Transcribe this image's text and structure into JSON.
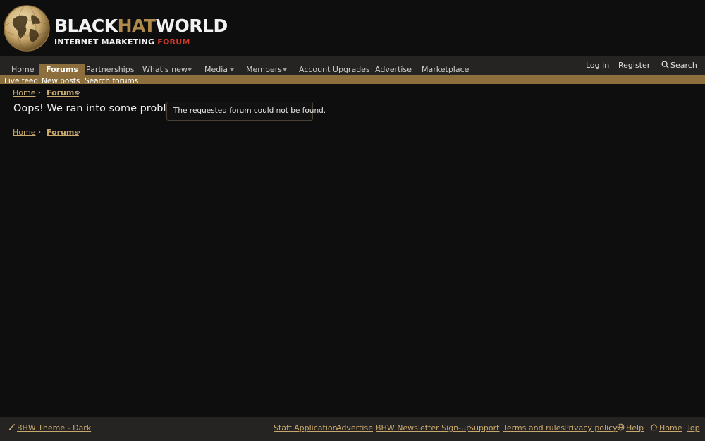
{
  "brand": {
    "name_part1": "BLACK",
    "name_part2": "HAT",
    "name_part3": "WORLD",
    "tagline_part1": "INTERNET MARKETING ",
    "tagline_part2": "FORUM"
  },
  "nav": {
    "tabs": [
      {
        "label": "Home"
      },
      {
        "label": "Forums"
      },
      {
        "label": "Partnerships"
      },
      {
        "label": "What's new"
      },
      {
        "label": "Media"
      },
      {
        "label": "Members"
      },
      {
        "label": "Account Upgrades"
      },
      {
        "label": "Advertise"
      },
      {
        "label": "Marketplace"
      }
    ],
    "user": {
      "login": "Log in",
      "register": "Register",
      "search": "Search"
    }
  },
  "subnav": {
    "items": [
      "Live feed",
      "New posts",
      "Search forums"
    ]
  },
  "breadcrumb": {
    "home": "Home",
    "forums": "Forums"
  },
  "error": {
    "title": "Oops! We ran into some problems.",
    "message": "The requested forum could not be found."
  },
  "footer": {
    "theme": "BHW Theme - Dark",
    "links": [
      "Staff Application",
      "Advertise",
      "BHW Newsletter Sign-up",
      "Support",
      "Terms and rules",
      "Privacy policy",
      "Help",
      "Home",
      "Top"
    ]
  },
  "colors": {
    "accent": "#8c6f3d",
    "link": "#c9a96e",
    "background": "#0f0e0e",
    "bar": "#262323"
  }
}
